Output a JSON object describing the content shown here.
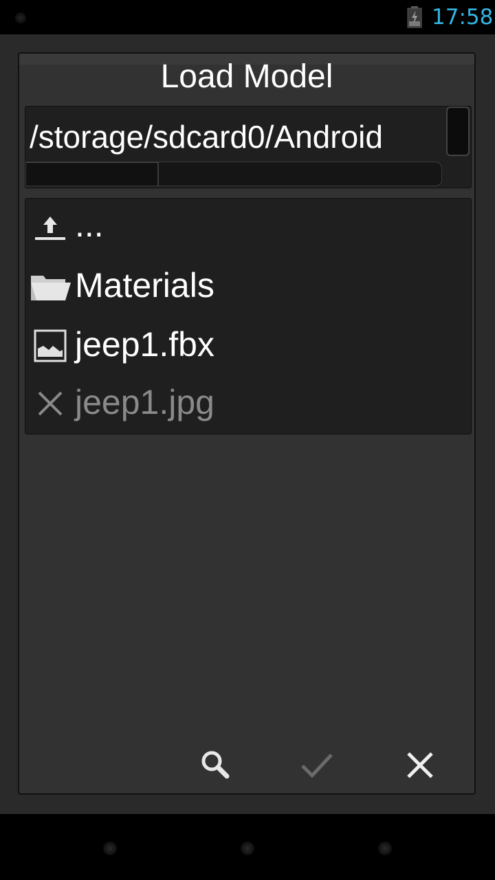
{
  "status_bar": {
    "time": "17:58",
    "battery_icon": "battery-charging-icon",
    "time_color": "#33b5e5"
  },
  "dialog": {
    "title": "Load Model",
    "path": "/storage/sdcard0/Android",
    "horizontal_scroll_fraction": 0.32
  },
  "files": [
    {
      "label": "...",
      "icon": "up-arrow-icon",
      "enabled": true
    },
    {
      "label": "Materials",
      "icon": "folder-icon",
      "enabled": true
    },
    {
      "label": "jeep1.fbx",
      "icon": "image-file-icon",
      "enabled": true
    },
    {
      "label": "jeep1.jpg",
      "icon": "close-icon",
      "enabled": false
    }
  ],
  "actions": [
    {
      "name": "search",
      "icon": "search-icon",
      "enabled": true
    },
    {
      "name": "confirm",
      "icon": "check-icon",
      "enabled": false
    },
    {
      "name": "cancel",
      "icon": "close-icon",
      "enabled": true
    }
  ]
}
